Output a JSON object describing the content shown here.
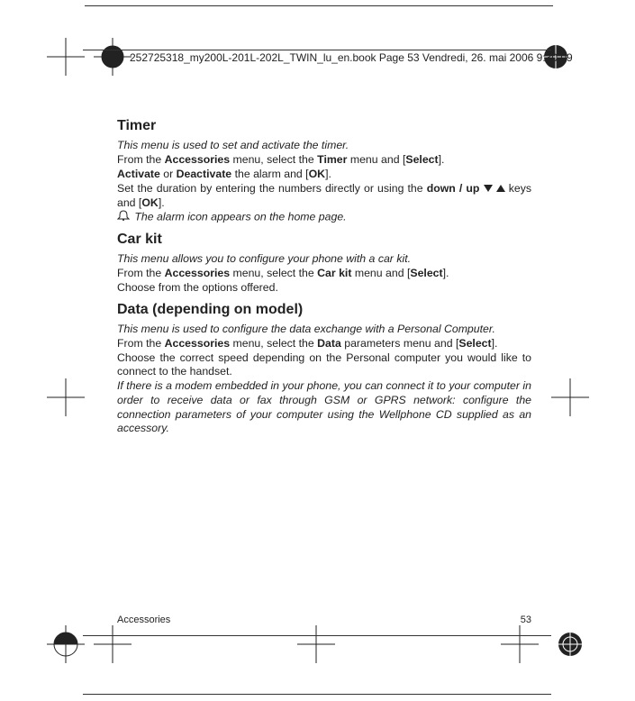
{
  "header_line": "252725318_my200L-201L-202L_TWIN_lu_en.book  Page 53  Vendredi, 26. mai 2006  9:30 09",
  "timer": {
    "title": "Timer",
    "intro": "This menu is used to set and activate the timer.",
    "line1_a": "From the ",
    "line1_b": "Accessories",
    "line1_c": " menu, select the ",
    "line1_d": "Timer",
    "line1_e": " menu and [",
    "line1_f": "Select",
    "line1_g": "].",
    "line2_a": "Activate",
    "line2_b": " or ",
    "line2_c": "Deactivate",
    "line2_d": " the alarm and [",
    "line2_e": "OK",
    "line2_f": "].",
    "line3_a": "Set the duration by entering the numbers directly or using the ",
    "line3_b": "down / up",
    "line3_c": " keys and [",
    "line3_d": "OK",
    "line3_e": "].",
    "line4": " The alarm icon appears on the home page."
  },
  "carkit": {
    "title": "Car kit",
    "intro": "This menu allows you to configure your phone with a car kit.",
    "line1_a": "From the ",
    "line1_b": "Accessories",
    "line1_c": " menu, select the ",
    "line1_d": "Car kit",
    "line1_e": " menu and [",
    "line1_f": "Select",
    "line1_g": "].",
    "line2": "Choose from the options offered."
  },
  "data": {
    "title": "Data (depending on model)",
    "intro": "This menu is used to configure the data exchange with a Personal Computer.",
    "line1_a": "From the ",
    "line1_b": "Accessories",
    "line1_c": " menu, select the ",
    "line1_d": "Data",
    "line1_e": " parameters menu and [",
    "line1_f": "Select",
    "line1_g": "].",
    "line2": "Choose the correct speed depending on the Personal computer you would like to connect to the handset.",
    "line3": "If there is a modem embedded in your phone, you can connect it to your computer in order to receive data or fax through GSM or GPRS network: configure the connection parameters of your computer using the Wellphone CD supplied as an accessory."
  },
  "footer": {
    "left": "Accessories",
    "right": "53"
  }
}
